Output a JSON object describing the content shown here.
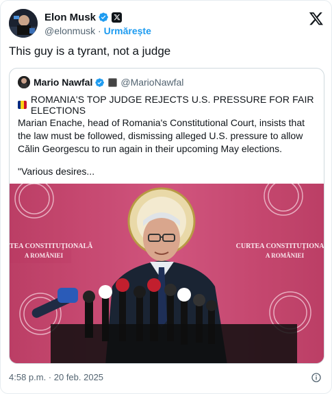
{
  "author": {
    "display_name": "Elon Musk",
    "handle": "@elonmusk",
    "separator": "·",
    "follow_label": "Urmărește"
  },
  "tweet": {
    "text": "This guy is a tyrant, not a judge",
    "timestamp": "4:58 p.m. · 20 feb. 2025"
  },
  "quoted": {
    "display_name": "Mario Nawfal",
    "handle": "@MarioNawfal",
    "headline": "ROMANIA'S TOP JUDGE REJECTS U.S. PRESSURE FOR FAIR ELECTIONS",
    "body": "Marian Enache, head of Romania's Constitutional Court, insists that the law must be followed, dismissing alleged U.S. pressure to allow Călin Georgescu to run again in their upcoming May elections.",
    "continuation": "\"Various desires...",
    "flag_colors": [
      "#002b7f",
      "#fcd116",
      "#ce1126"
    ]
  },
  "media": {
    "backdrop_text_line1": "CURTEA CONSTITUȚIONALĂ",
    "backdrop_text_line2": "A ROMÂNIEI",
    "backdrop_color": "#c23a66"
  },
  "colors": {
    "accent": "#1d9bf0",
    "verified": "#1d9bf0",
    "text": "#0f1419",
    "muted": "#536471",
    "border": "#cfd9de"
  },
  "icons": {
    "verified": "verified-badge-icon",
    "x_logo": "x-logo-icon",
    "info": "info-icon"
  }
}
